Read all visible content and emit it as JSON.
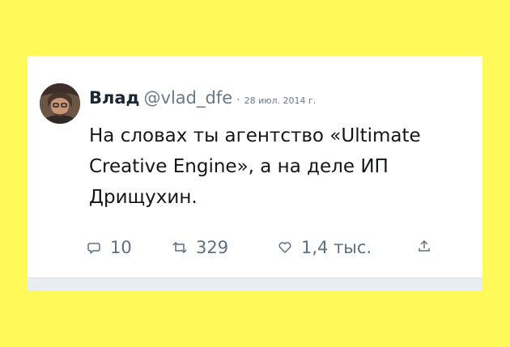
{
  "tweet": {
    "author_name": "Влад",
    "handle": "@vlad_dfe",
    "separator": "·",
    "date": "28 июл. 2014 г.",
    "text": "На словах ты агентство «Ultimate Creative Engine», а на деле ИП Дрищухин.",
    "actions": {
      "replies": "10",
      "retweets": "329",
      "likes": "1,4 тыс."
    }
  },
  "colors": {
    "background": "#fff95a",
    "card": "#ffffff",
    "name": "#1c2733",
    "muted": "#68778a",
    "text": "#14171a"
  },
  "icons": {
    "reply": "reply-bubble-icon",
    "retweet": "retweet-icon",
    "like": "heart-icon",
    "share": "share-icon"
  }
}
